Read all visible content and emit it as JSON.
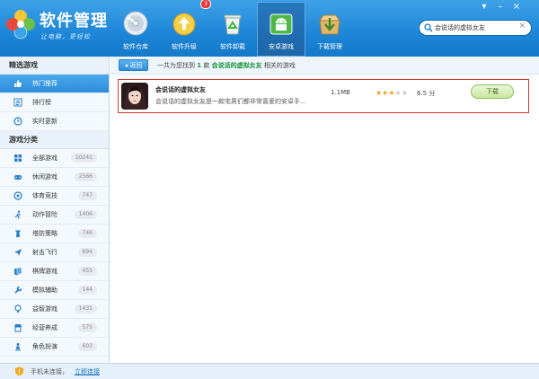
{
  "app": {
    "brand": "软件管理",
    "slogan": "让电脑，更轻松"
  },
  "nav": [
    {
      "label": "软件仓库",
      "icon": "disc-icon"
    },
    {
      "label": "软件升级",
      "icon": "upgrade-icon",
      "badge": "3"
    },
    {
      "label": "软件卸载",
      "icon": "recycle-bin-icon"
    },
    {
      "label": "安卓游戏",
      "icon": "android-icon",
      "active": true
    },
    {
      "label": "下载管理",
      "icon": "download-box-icon"
    }
  ],
  "window_controls": {
    "menu": "▾",
    "minimize": "–",
    "close": "×"
  },
  "search": {
    "value": "会说话的虚拟女友",
    "clear": "×"
  },
  "sidebar": {
    "featured_heading": "精选游戏",
    "featured": [
      {
        "label": "热门推荐",
        "icon": "thumb-up-icon",
        "active": true
      },
      {
        "label": "排行榜",
        "icon": "list-icon"
      },
      {
        "label": "实时更新",
        "icon": "clock-icon"
      }
    ],
    "category_heading": "游戏分类",
    "categories": [
      {
        "label": "全部游戏",
        "count": "10241",
        "icon": "grid-icon"
      },
      {
        "label": "休闲游戏",
        "count": "2566",
        "icon": "casual-icon"
      },
      {
        "label": "体育竞技",
        "count": "747",
        "icon": "ball-icon"
      },
      {
        "label": "动作冒险",
        "count": "1406",
        "icon": "runner-icon"
      },
      {
        "label": "塔防策略",
        "count": "746",
        "icon": "tower-icon"
      },
      {
        "label": "射击飞行",
        "count": "894",
        "icon": "plane-icon"
      },
      {
        "label": "棋牌游戏",
        "count": "455",
        "icon": "cards-icon"
      },
      {
        "label": "模拟辅助",
        "count": "144",
        "icon": "wrench-icon"
      },
      {
        "label": "益智游戏",
        "count": "1431",
        "icon": "bulb-icon"
      },
      {
        "label": "经营养成",
        "count": "575",
        "icon": "shop-icon"
      },
      {
        "label": "角色扮演",
        "count": "603",
        "icon": "chess-icon"
      }
    ]
  },
  "main": {
    "back_label": "返回",
    "result_prefix": "一共为您找到",
    "result_count": "1",
    "result_unit": "款",
    "result_keyword": "会说话的虚拟女友",
    "result_suffix": "相关的游戏",
    "results": [
      {
        "name": "会说话的虚拟女友",
        "desc": "会说话的虚拟女友是一款宅男们都非常喜爱的安卓手...",
        "size": "1.1MB",
        "rating_value": 6.5,
        "rating_text": "6.5 分",
        "download_label": "下载"
      }
    ]
  },
  "status": {
    "text": "手机未连接，",
    "link": "立即连接"
  },
  "colors": {
    "header": "#1d86d8",
    "result_border": "#d9342b",
    "highlight": "#17953b",
    "star_on": "#f0a020",
    "star_off": "#c8c8c8"
  }
}
